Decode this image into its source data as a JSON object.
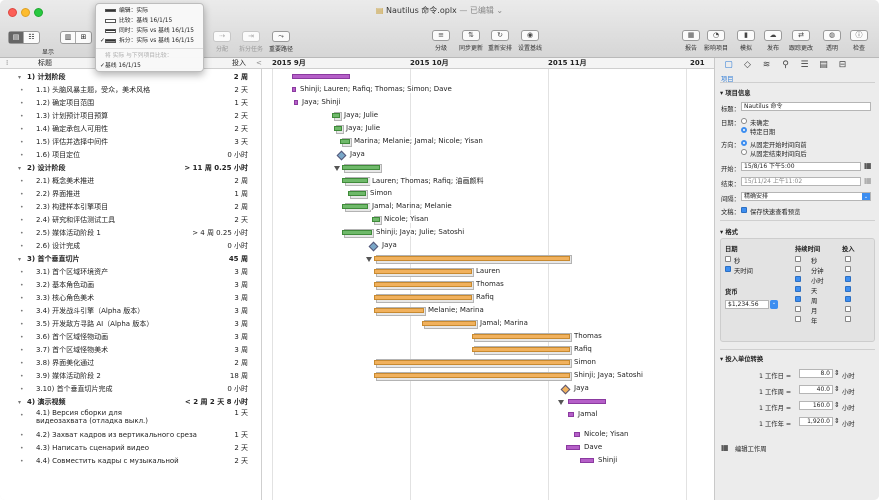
{
  "window": {
    "title": "Nautilus 命令.oplx",
    "edited": "— 已编辑 ⌄"
  },
  "toolbar": {
    "view_label": "显示",
    "split_label": "分配",
    "split_task_label": "拆分任务",
    "critical_path_label": "重要路径",
    "level_label": "分级",
    "sync_label": "同步更新",
    "reschedule_label": "重新安排",
    "set_baseline_label": "设置基线",
    "report_label": "报告",
    "publish_impact_label": "影响项目",
    "simulate_label": "模拟",
    "publish_label": "发布",
    "track_changes_label": "跟踪更改",
    "transparent_label": "透明",
    "inspect_label": "检查"
  },
  "baseline_menu": {
    "items": [
      {
        "label": "编辑：实际",
        "checked": false
      },
      {
        "label": "比较：基线 16/1/15",
        "checked": false
      },
      {
        "label": "同时：实际 vs 基线 16/1/15",
        "checked": false
      },
      {
        "label": "拆分：实际 vs 基线 16/1/15",
        "checked": true
      }
    ],
    "section": "将 实际 与下列项目比较：",
    "baseline": "基线 16/1/15"
  },
  "outline": {
    "col_title": "标题",
    "col_effort": "投入",
    "rows": [
      {
        "num": "1)",
        "title": "计划阶段",
        "effort": "2 周",
        "group": true
      },
      {
        "num": "1.1)",
        "title": "头脑风暴主题，受众，美术风格",
        "effort": "2 天"
      },
      {
        "num": "1.2)",
        "title": "确定项目范围",
        "effort": "1 天"
      },
      {
        "num": "1.3)",
        "title": "计划预计项目预算",
        "effort": "2 天"
      },
      {
        "num": "1.4)",
        "title": "确定承包人可用性",
        "effort": "2 天"
      },
      {
        "num": "1.5)",
        "title": "评估并选择中间件",
        "effort": "3 天"
      },
      {
        "num": "1.6)",
        "title": "项目定位",
        "effort": "0 小时"
      },
      {
        "num": "2)",
        "title": "设计阶段",
        "effort": "> 11 周 0.25 小时",
        "group": true
      },
      {
        "num": "2.1)",
        "title": "概念美术推进",
        "effort": "2 周"
      },
      {
        "num": "2.2)",
        "title": "界面推进",
        "effort": "1 周"
      },
      {
        "num": "2.3)",
        "title": "构建样本引擎项目",
        "effort": "2 周"
      },
      {
        "num": "2.4)",
        "title": "研究和评估测试工具",
        "effort": "2 天"
      },
      {
        "num": "2.5)",
        "title": "媒体活动阶段 1",
        "effort": "> 4 周 0.25 小时"
      },
      {
        "num": "2.6)",
        "title": "设计完成",
        "effort": "0 小时"
      },
      {
        "num": "3)",
        "title": "首个垂直切片",
        "effort": "45 周",
        "group": true
      },
      {
        "num": "3.1)",
        "title": "首个区域环境资产",
        "effort": "3 周"
      },
      {
        "num": "3.2)",
        "title": "基本角色动画",
        "effort": "3 周"
      },
      {
        "num": "3.3)",
        "title": "核心角色美术",
        "effort": "3 周"
      },
      {
        "num": "3.4)",
        "title": "开发战斗引擎（Alpha 版本）",
        "effort": "3 周"
      },
      {
        "num": "3.5)",
        "title": "开发敌方寻路 AI（Alpha 版本）",
        "effort": "3 周"
      },
      {
        "num": "3.6)",
        "title": "首个区域怪物动画",
        "effort": "3 周"
      },
      {
        "num": "3.7)",
        "title": "首个区域怪物美术",
        "effort": "3 周"
      },
      {
        "num": "3.8)",
        "title": "界面美化通过",
        "effort": "2 周"
      },
      {
        "num": "3.9)",
        "title": "媒体活动阶段 2",
        "effort": "18 周"
      },
      {
        "num": "3.10)",
        "title": "首个垂直切片完成",
        "effort": "0 小时"
      },
      {
        "num": "4)",
        "title": "演示视频",
        "effort": "< 2 周 2 天 8 小时",
        "group": true
      },
      {
        "num": "4.1)",
        "title": "Версия сборки для видеозахвата (отладка выкл.)",
        "effort": "1 天"
      },
      {
        "num": "4.2)",
        "title": "Захват кадров из вертикального среза",
        "effort": "1 天"
      },
      {
        "num": "4.3)",
        "title": "Написать сценарий видео",
        "effort": "2 天"
      },
      {
        "num": "4.4)",
        "title": "Совместить кадры с музыкальной",
        "effort": "2 天"
      }
    ]
  },
  "gantt": {
    "months": [
      "2015 9月",
      "2015 10月",
      "2015 11月",
      "201"
    ],
    "labels": [
      "Shinji; Lauren; Rafiq; Thomas; Simon; Dave",
      "Jaya; Shinji",
      "Jaya; Julie",
      "Jaya; Julie",
      "Marina; Melanie; Jamal; Nicole; Yisan",
      "Jaya",
      "Lauren; Thomas; Rafiq; 油画颜料",
      "Simon",
      "Jamal; Marina; Melanie",
      "Nicole; Yisan",
      "Shinji; Jaya; Julie; Satoshi",
      "Jaya",
      "Lauren",
      "Thomas",
      "Rafiq",
      "Melanie; Marina",
      "Jamal; Marina",
      "Thomas",
      "Rafiq",
      "Simon",
      "Shinji; Jaya; Satoshi",
      "Jaya",
      "Jamal",
      "Nicole; Yisan",
      "Dave",
      "Shinji"
    ]
  },
  "inspector": {
    "tab_label": "项目",
    "project_info": "项目信息",
    "title_label": "标题：",
    "title_value": "Nautilus 命令",
    "date_label": "日期：",
    "date_opt1": "未确定",
    "date_opt2": "特定日期",
    "direction_label": "方向：",
    "dir_opt1": "从固定开始时间向前",
    "dir_opt2": "从固定结束时间向后",
    "start_label": "开始：",
    "start_value": "15/8/16 下午5:00",
    "end_label": "结束：",
    "end_value": "15/11/24 上午11:02",
    "granularity_label": "间隔：",
    "granularity_value": "精确安排",
    "doc_label": "文稿：",
    "doc_check": "保存快速查看预览",
    "format_label": "格式",
    "date_col": "日期",
    "duration_col": "持续时间",
    "effort_col": "投入",
    "sec": "秒",
    "day_time": "天时间",
    "min": "分钟",
    "hour": "小时",
    "day": "天",
    "week": "周",
    "month": "月",
    "year": "年",
    "currency_label": "货币",
    "currency_value": "$1,234.56",
    "conv_label": "投入单位转换",
    "conv": [
      {
        "lhs": "1 工作日 =",
        "val": "8.0",
        "unit": "小时"
      },
      {
        "lhs": "1 工作周 =",
        "val": "40.0",
        "unit": "小时"
      },
      {
        "lhs": "1 工作月 =",
        "val": "160.0",
        "unit": "小时"
      },
      {
        "lhs": "1 工作年 =",
        "val": "1,920.0",
        "unit": "小时"
      }
    ],
    "edit_calendar": "编辑工作周"
  }
}
